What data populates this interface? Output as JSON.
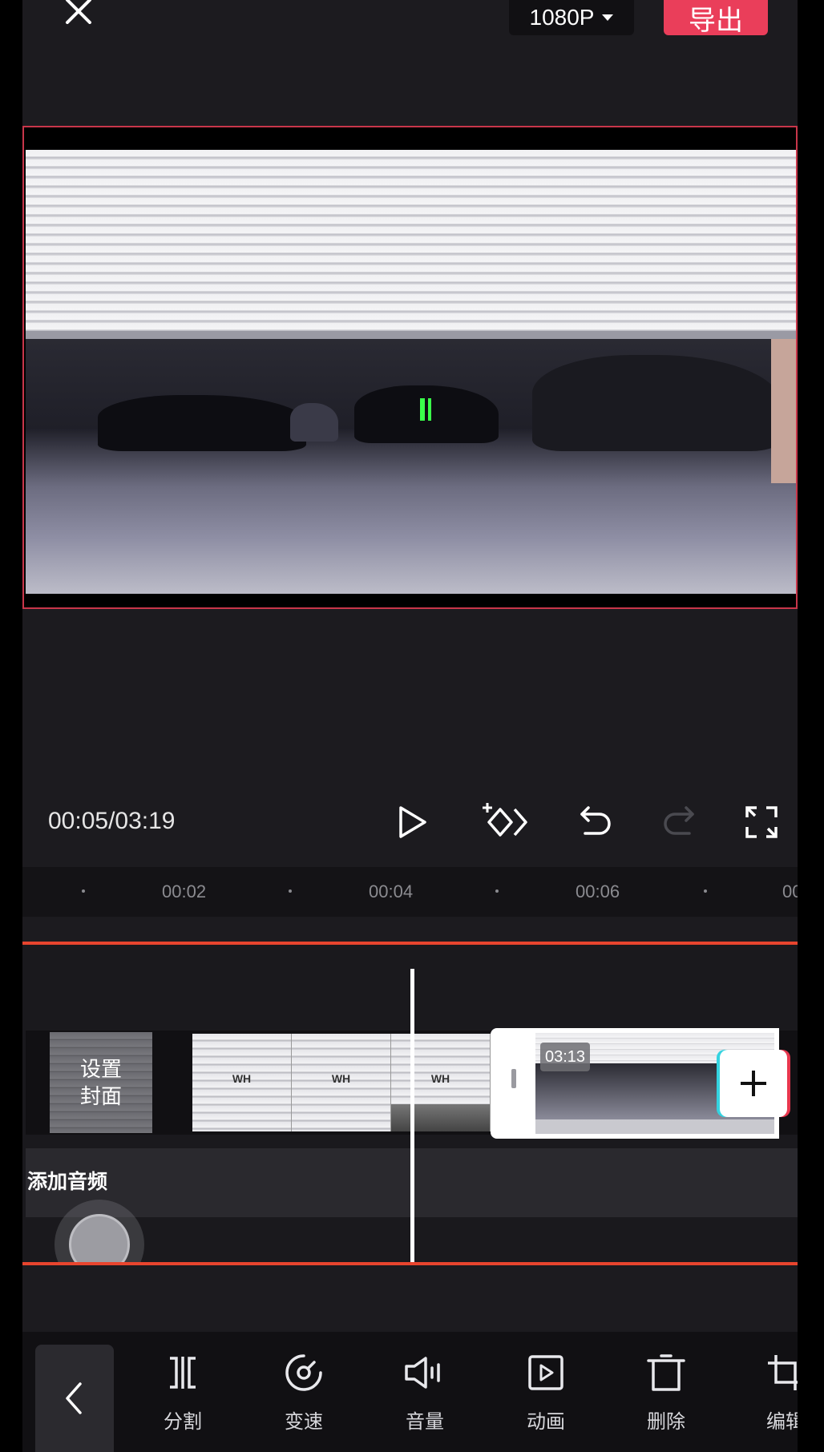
{
  "header": {
    "close_icon": "close-icon",
    "resolution": "1080P",
    "export_label": "导出",
    "export_color": "#ea3e5a"
  },
  "player": {
    "timecode": "00:05/03:19",
    "controls": [
      "play-icon",
      "keyframe-add-icon",
      "undo-icon",
      "redo-icon",
      "fullscreen-icon"
    ]
  },
  "ruler": {
    "labels": [
      "00:02",
      "00:04",
      "00:06",
      "00"
    ]
  },
  "timeline": {
    "cover_label_line1": "设置",
    "cover_label_line2": "封面",
    "clip_logo": "WH",
    "selected_clip_duration": "03:13",
    "audio_label": "添加音频",
    "highlight_color": "#e8452e"
  },
  "toolbar": {
    "items": [
      {
        "label": "分割",
        "icon": "split-icon"
      },
      {
        "label": "变速",
        "icon": "speed-icon"
      },
      {
        "label": "音量",
        "icon": "volume-icon"
      },
      {
        "label": "动画",
        "icon": "animation-icon"
      },
      {
        "label": "删除",
        "icon": "delete-icon"
      },
      {
        "label": "编辑",
        "icon": "edit-crop-icon"
      }
    ]
  }
}
